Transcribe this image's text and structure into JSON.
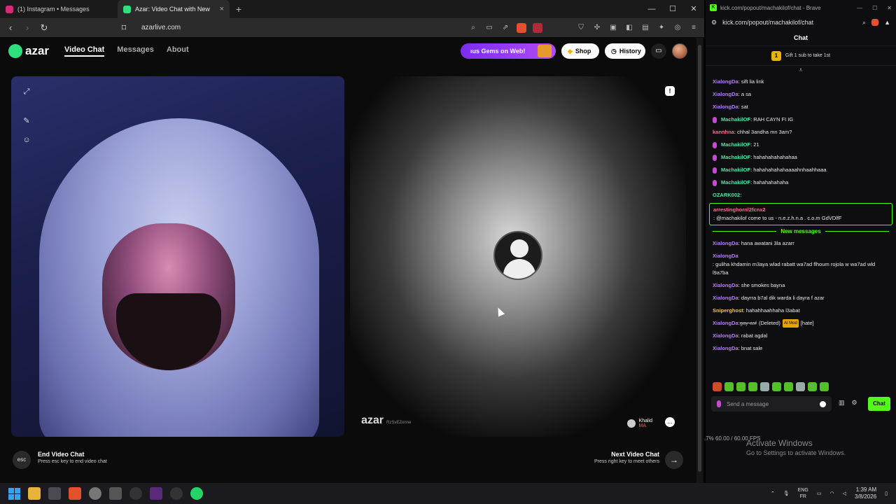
{
  "browser": {
    "tabs": [
      {
        "title": "(1) Instagram • Messages"
      },
      {
        "title": "Azar: Video Chat with New Pe"
      }
    ],
    "url": "azarlive.com"
  },
  "site": {
    "logo_text": "azar",
    "nav": [
      "Video Chat",
      "Messages",
      "About"
    ],
    "gems_promo": "ıus Gems on Web!",
    "shop_label": "Shop",
    "history_label": "History"
  },
  "video": {
    "watermark": "azar",
    "watermark_sub": "RzSvEZonne",
    "peer_name": "Khalid",
    "peer_country": "MA"
  },
  "hints": {
    "esc_key": "esc",
    "end_title": "End Video Chat",
    "end_sub": "Press esc key to end video chat",
    "next_title": "Next Video Chat",
    "next_sub": "Press right key to meet others"
  },
  "popup": {
    "title": "kick.com/popout/machakilof/chat - Brave",
    "address": "kick.com/popout/machakilof/chat",
    "chat_header": "Chat",
    "gift_text": "Gift 1 sub to take 1st",
    "gift_rank": "1",
    "messages_before": [
      {
        "user": "XialongDa",
        "color": "#b57bff",
        "text": ": sift lia link",
        "mic": false
      },
      {
        "user": "XialongDa",
        "color": "#b57bff",
        "text": ": a sa",
        "mic": false
      },
      {
        "user": "XialongDa",
        "color": "#b57bff",
        "text": ": sat",
        "mic": false
      },
      {
        "user": "MachakilOF",
        "color": "#53e3a6",
        "text": ": RAH CAYN FI IG",
        "mic": true
      },
      {
        "user": "kannhna",
        "color": "#ff6b8a",
        "text": ": chhal 3andha mn 3am?",
        "mic": false
      },
      {
        "user": "MachakilOF",
        "color": "#53e3a6",
        "text": ": 21",
        "mic": true
      },
      {
        "user": "MachakilOF",
        "color": "#53e3a6",
        "text": ": hahahahahahahaa",
        "mic": true
      },
      {
        "user": "MachakilOF",
        "color": "#53e3a6",
        "text": ": hahahahahahaaaahnhaahhaaa",
        "mic": true
      },
      {
        "user": "MachakilOF",
        "color": "#53e3a6",
        "text": ": hahahahahaha",
        "mic": true
      },
      {
        "user": "OZARK002",
        "color": "#53e3a6",
        "text": ":",
        "mic": false
      }
    ],
    "highlight_msg": {
      "user": "arrestinghornl2fcnx2",
      "color": "#ff6b8a",
      "text": ": @machakilof come to us - n.e.z.h.n.a . c.o.m GdVDlfF"
    },
    "new_messages_label": "New messages",
    "messages_after": [
      {
        "user": "XialongDa",
        "color": "#b57bff",
        "text": ": hana awatani 3la azarr"
      },
      {
        "user": "XialongDa",
        "color": "#b57bff",
        "text": ": guliha khdamin m3aya wlad rabatt wa7ad flhoum rojola w wa7ad wld l9a7ba"
      },
      {
        "user": "XialongDa",
        "color": "#b57bff",
        "text": ": she smokes bayna"
      },
      {
        "user": "XialongDa",
        "color": "#b57bff",
        "text": ": dayrra b7al dik warda li dayra f azar"
      },
      {
        "user": "Sniperghost",
        "color": "#e8c36b",
        "text": ": hahahhaahhaha l3abat"
      }
    ],
    "deleted_msg": {
      "user": "XialongDa",
      "color": "#b57bff",
      "struck": "gay asf",
      "deleted": "(Deleted)",
      "mod": "AI Mod",
      "tag": "[hate]"
    },
    "messages_tail": [
      {
        "user": "XialongDa",
        "color": "#b57bff",
        "text": ": rabat agdal"
      },
      {
        "user": "XialongDa",
        "color": "#b57bff",
        "text": ": bnat sale"
      }
    ],
    "send_placeholder": "Send a message",
    "chat_button": "Chat"
  },
  "overlay": {
    "fps": ".7%   60.00 / 60.00 FPS",
    "activate_title": "Activate Windows",
    "activate_sub": "Go to Settings to activate Windows."
  },
  "taskbar": {
    "lang_top": "ENG",
    "lang_bottom": "FR",
    "time": "1:39 AM",
    "date": "3/8/2026"
  }
}
